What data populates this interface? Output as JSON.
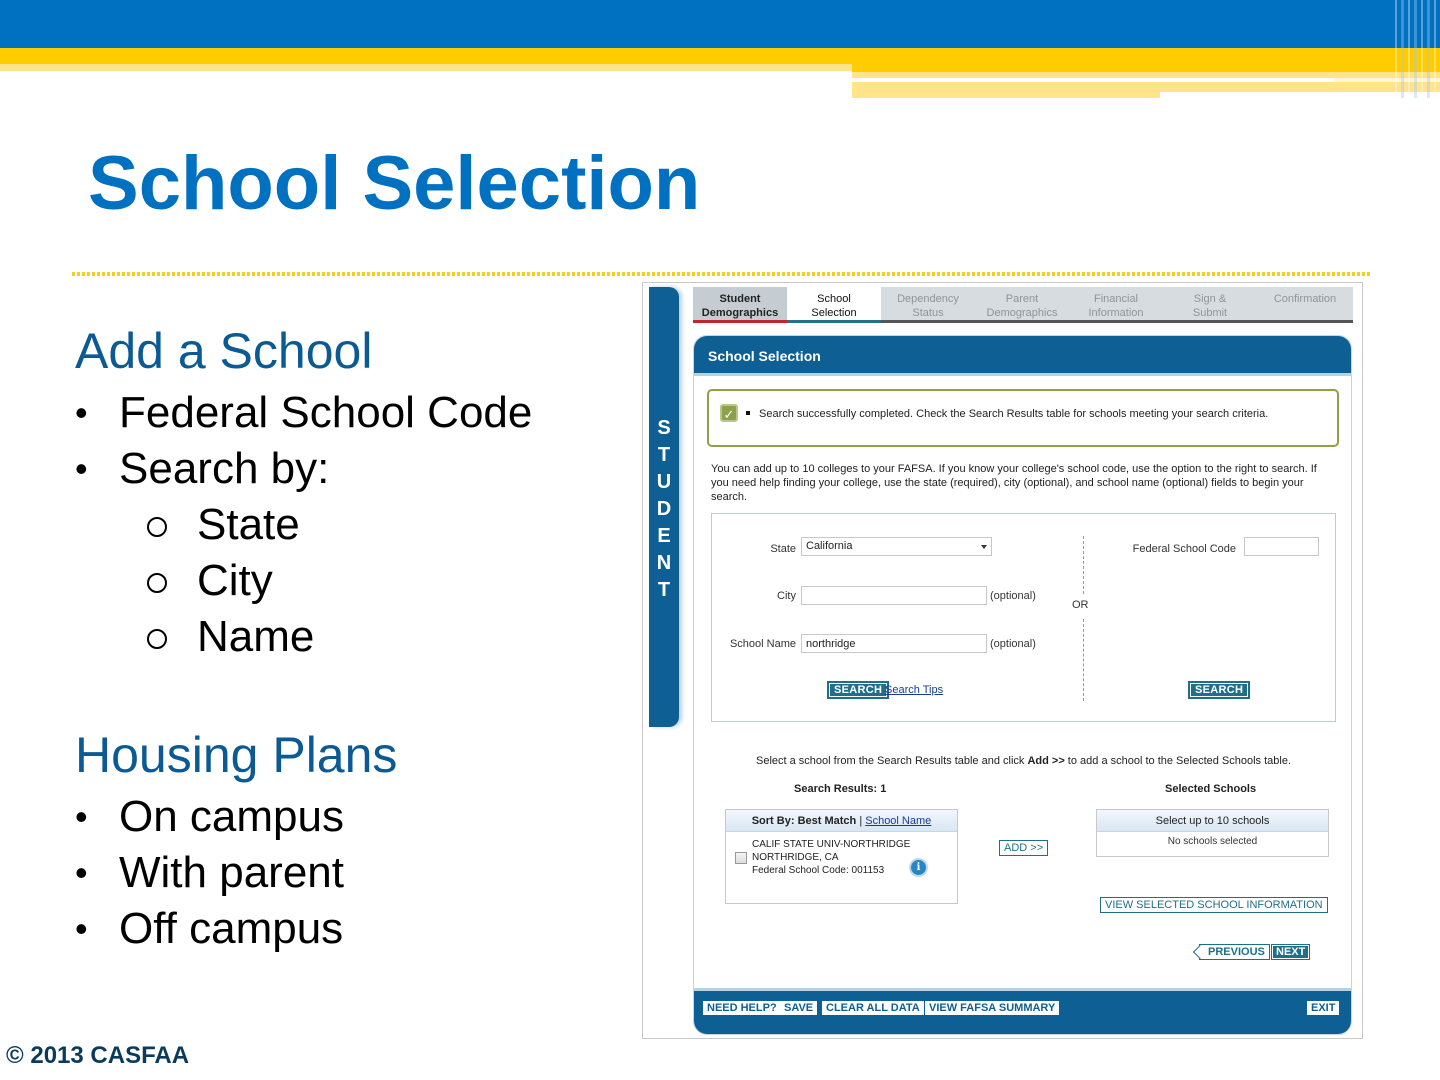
{
  "slide": {
    "title": "School Selection",
    "sections": [
      {
        "heading": "Add a School",
        "bullets": [
          "Federal School Code",
          "Search by:"
        ],
        "sub_bullets": [
          "State",
          "City",
          "Name"
        ]
      },
      {
        "heading": "Housing Plans",
        "bullets": [
          "On campus",
          "With parent",
          "Off campus"
        ]
      }
    ],
    "copyright": "© 2013 CASFAA",
    "colors": {
      "title_blue": "#0070c0",
      "banner_yellow": "#ffcc00",
      "heading_blue": "#0b5a94"
    }
  },
  "fafsa": {
    "side_label_letters": [
      "S",
      "T",
      "U",
      "D",
      "E",
      "N",
      "T"
    ],
    "steps": [
      {
        "line1": "Student",
        "line2": "Demographics",
        "state": "done"
      },
      {
        "line1": "School",
        "line2": "Selection",
        "state": "active"
      },
      {
        "line1": "Dependency",
        "line2": "Status",
        "state": "pending"
      },
      {
        "line1": "Parent",
        "line2": "Demographics",
        "state": "pending"
      },
      {
        "line1": "Financial",
        "line2": "Information",
        "state": "pending"
      },
      {
        "line1": "Sign &",
        "line2": "Submit",
        "state": "pending"
      },
      {
        "line1": "Confirmation",
        "line2": "",
        "state": "pending"
      }
    ],
    "panel_title": "School Selection",
    "success_message": "Search successfully completed. Check the Search Results table for schools meeting your search criteria.",
    "intro": "You can add up to 10 colleges to your FAFSA. If you know your college's school code, use the option to the right to search. If you need help finding your college, use the state (required), city (optional), and school name (optional) fields to begin your search.",
    "search": {
      "state_label": "State",
      "state_value": "California",
      "city_label": "City",
      "city_value": "",
      "school_name_label": "School Name",
      "school_name_value": "northridge",
      "optional": "(optional)",
      "or": "OR",
      "federal_code_label": "Federal School Code",
      "federal_code_value": "",
      "search_button": "SEARCH",
      "search_tips": "Search Tips"
    },
    "instruction_pre": "Select a school from the Search Results table and click ",
    "instruction_bold": "Add >>",
    "instruction_post": " to add a school to the Selected Schools table.",
    "results": {
      "title": "Search Results: 1",
      "sort_by": "Sort By:",
      "sort_current": "Best Match",
      "sort_separator": "|",
      "sort_alt": "School Name",
      "rows": [
        {
          "name": "CALIF STATE UNIV-NORTHRIDGE",
          "location": "NORTHRIDGE, CA",
          "code": "Federal School Code: 001153",
          "checked": false
        }
      ]
    },
    "add_button": "ADD >>",
    "selected": {
      "title": "Selected Schools",
      "header": "Select up to 10 schools",
      "empty": "No schools selected",
      "view_button": "VIEW SELECTED SCHOOL INFORMATION"
    },
    "nav": {
      "previous": "PREVIOUS",
      "next": "NEXT"
    },
    "footer": {
      "need_help": "NEED HELP?",
      "save": "SAVE",
      "clear": "CLEAR ALL DATA",
      "summary": "VIEW FAFSA SUMMARY",
      "exit": "EXIT"
    },
    "colors": {
      "primary": "#0e5f94",
      "button_teal": "#1f6f8b",
      "success_green": "#8da04a",
      "error_red": "#c0272d"
    }
  }
}
